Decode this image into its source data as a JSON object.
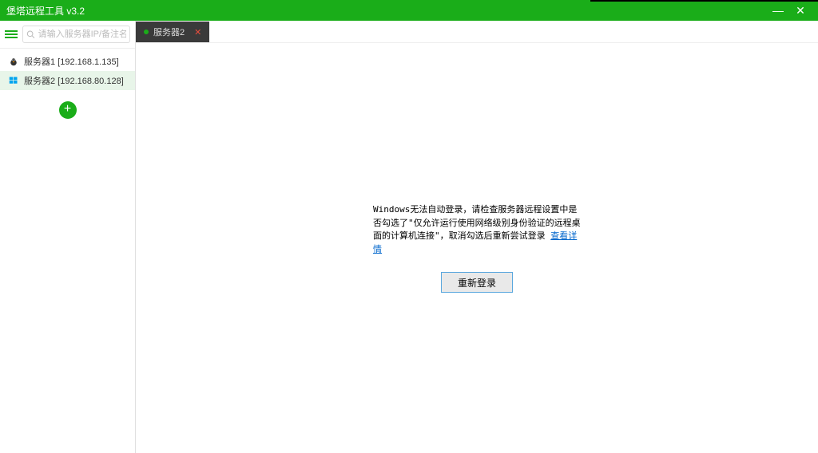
{
  "titlebar": {
    "title": "堡塔远程工具  v3.2"
  },
  "search": {
    "placeholder": "请输入服务器IP/备注名称"
  },
  "servers": [
    {
      "label": "服务器1 [192.168.1.135]"
    },
    {
      "label": "服务器2 [192.168.80.128]"
    }
  ],
  "tabs": [
    {
      "label": "服务器2"
    }
  ],
  "message": {
    "text": "Windows无法自动登录，请检查服务器远程设置中是否勾选了\"仅允许运行使用网络级别身份验证的远程桌面的计算机连接\"，取消勾选后重新尝试登录",
    "link": "查看详情",
    "button": "重新登录"
  }
}
